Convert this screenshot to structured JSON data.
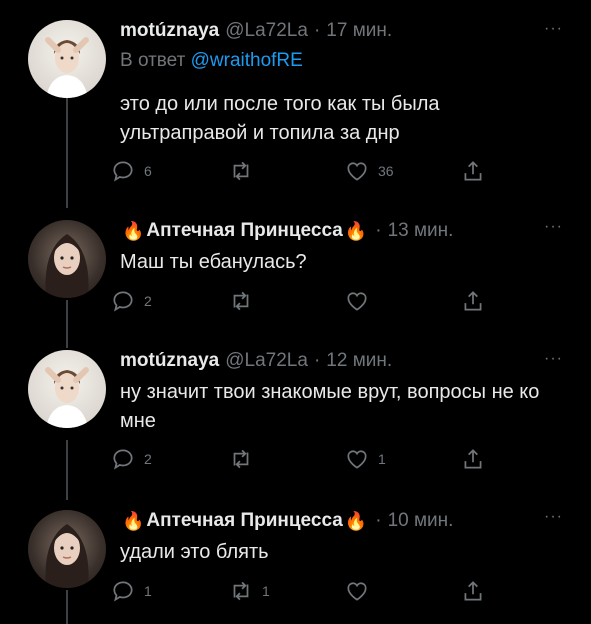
{
  "tweets": [
    {
      "author": "motúznaya",
      "handle": "@La72La",
      "sep": "·",
      "time": "17 мин.",
      "reply_prefix": "В ответ",
      "reply_handle": "@wraithofRE",
      "text": "это до или после того как ты была ультраправой и топила за днр",
      "counts": {
        "reply": "6",
        "retweet": "",
        "like": "36"
      },
      "more": "···"
    },
    {
      "author": "Аптечная Принцесса",
      "flame": "🔥",
      "sep": "·",
      "time": "13 мин.",
      "text": "Маш ты ебанулась?",
      "counts": {
        "reply": "2",
        "retweet": "",
        "like": ""
      },
      "more": "···"
    },
    {
      "author": "motúznaya",
      "handle": "@La72La",
      "sep": "·",
      "time": "12 мин.",
      "text": "ну значит твои знакомые врут, вопросы не ко мне",
      "counts": {
        "reply": "2",
        "retweet": "",
        "like": "1"
      },
      "more": "···"
    },
    {
      "author": "Аптечная Принцесса",
      "flame": "🔥",
      "sep": "·",
      "time": "10 мин.",
      "text": "удали это блять",
      "counts": {
        "reply": "1",
        "retweet": "1",
        "like": ""
      },
      "more": "···"
    }
  ],
  "icons": {
    "reply": "reply-icon",
    "retweet": "retweet-icon",
    "like": "heart-icon",
    "share": "share-icon",
    "more": "more-icon"
  },
  "colors": {
    "background": "#000000",
    "text": "#e7e9ea",
    "muted": "#71767b",
    "link": "#1d9bf0",
    "thread_line": "#3e4144"
  }
}
